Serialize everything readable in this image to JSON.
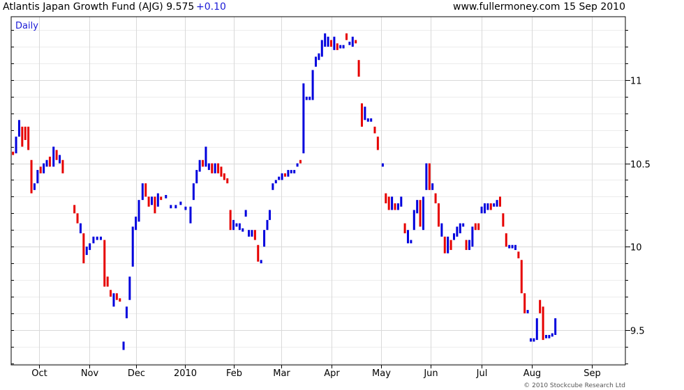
{
  "header": {
    "title": "Atlantis Japan Growth Fund (AJG) 9.575",
    "change": "+0.10",
    "site": "www.fullermoney.com",
    "date": "15 Sep 2010"
  },
  "footer": {
    "copyright": "© 2010 Stockcube Research Ltd"
  },
  "colors": {
    "up": "#0000dd",
    "down": "#e60000",
    "grid": "#d9d9d9",
    "frame": "#000000"
  },
  "chart_data": {
    "type": "bar",
    "period_label": "Daily",
    "ylim": [
      9.29,
      11.38
    ],
    "yticks": [
      9.5,
      10,
      10.5,
      11
    ],
    "y_tick_labels": [
      "9.5",
      "10",
      "10.5",
      "11"
    ],
    "x_tick_labels": [
      "Oct",
      "Nov",
      "Dec",
      "2010",
      "Feb",
      "Mar",
      "Apr",
      "May",
      "Jun",
      "Jul",
      "Aug",
      "Sep"
    ],
    "x_tick_positions": [
      0.045,
      0.127,
      0.203,
      0.283,
      0.363,
      0.44,
      0.522,
      0.602,
      0.683,
      0.766,
      0.848,
      0.945
    ],
    "bars": [
      {
        "x": 0.003,
        "low": 10.55,
        "high": 10.57,
        "up": false
      },
      {
        "x": 0.008,
        "low": 10.56,
        "high": 10.66,
        "up": true
      },
      {
        "x": 0.013,
        "low": 10.66,
        "high": 10.76,
        "up": true
      },
      {
        "x": 0.018,
        "low": 10.6,
        "high": 10.72,
        "up": false
      },
      {
        "x": 0.023,
        "low": 10.64,
        "high": 10.72,
        "up": false
      },
      {
        "x": 0.028,
        "low": 10.58,
        "high": 10.72,
        "up": false
      },
      {
        "x": 0.033,
        "low": 10.32,
        "high": 10.52,
        "up": false
      },
      {
        "x": 0.038,
        "low": 10.34,
        "high": 10.38,
        "up": true
      },
      {
        "x": 0.043,
        "low": 10.38,
        "high": 10.46,
        "up": true
      },
      {
        "x": 0.048,
        "low": 10.44,
        "high": 10.48,
        "up": false
      },
      {
        "x": 0.053,
        "low": 10.44,
        "high": 10.5,
        "up": true
      },
      {
        "x": 0.058,
        "low": 10.48,
        "high": 10.52,
        "up": true
      },
      {
        "x": 0.063,
        "low": 10.48,
        "high": 10.54,
        "up": false
      },
      {
        "x": 0.069,
        "low": 10.48,
        "high": 10.6,
        "up": true
      },
      {
        "x": 0.074,
        "low": 10.52,
        "high": 10.58,
        "up": false
      },
      {
        "x": 0.079,
        "low": 10.5,
        "high": 10.55,
        "up": true
      },
      {
        "x": 0.084,
        "low": 10.44,
        "high": 10.52,
        "up": false
      },
      {
        "x": 0.103,
        "low": 10.2,
        "high": 10.25,
        "up": false
      },
      {
        "x": 0.108,
        "low": 10.14,
        "high": 10.2,
        "up": false
      },
      {
        "x": 0.113,
        "low": 10.08,
        "high": 10.14,
        "up": true
      },
      {
        "x": 0.118,
        "low": 9.9,
        "high": 10.08,
        "up": false
      },
      {
        "x": 0.123,
        "low": 9.95,
        "high": 10.0,
        "up": true
      },
      {
        "x": 0.128,
        "low": 9.98,
        "high": 10.02,
        "up": true
      },
      {
        "x": 0.134,
        "low": 10.02,
        "high": 10.06,
        "up": true
      },
      {
        "x": 0.14,
        "low": 10.04,
        "high": 10.06,
        "up": true
      },
      {
        "x": 0.146,
        "low": 10.04,
        "high": 10.06,
        "up": true
      },
      {
        "x": 0.152,
        "low": 9.76,
        "high": 10.04,
        "up": false
      },
      {
        "x": 0.157,
        "low": 9.76,
        "high": 9.82,
        "up": false
      },
      {
        "x": 0.162,
        "low": 9.7,
        "high": 9.74,
        "up": false
      },
      {
        "x": 0.167,
        "low": 9.64,
        "high": 9.72,
        "up": true
      },
      {
        "x": 0.172,
        "low": 9.68,
        "high": 9.72,
        "up": false
      },
      {
        "x": 0.177,
        "low": 9.67,
        "high": 9.69,
        "up": false
      },
      {
        "x": 0.183,
        "low": 9.38,
        "high": 9.43,
        "up": true
      },
      {
        "x": 0.188,
        "low": 9.57,
        "high": 9.64,
        "up": true
      },
      {
        "x": 0.193,
        "low": 9.68,
        "high": 9.82,
        "up": true
      },
      {
        "x": 0.198,
        "low": 9.88,
        "high": 10.12,
        "up": true
      },
      {
        "x": 0.203,
        "low": 10.1,
        "high": 10.18,
        "up": true
      },
      {
        "x": 0.208,
        "low": 10.15,
        "high": 10.28,
        "up": true
      },
      {
        "x": 0.214,
        "low": 10.28,
        "high": 10.38,
        "up": true
      },
      {
        "x": 0.219,
        "low": 10.3,
        "high": 10.38,
        "up": false
      },
      {
        "x": 0.224,
        "low": 10.24,
        "high": 10.3,
        "up": false
      },
      {
        "x": 0.229,
        "low": 10.25,
        "high": 10.3,
        "up": true
      },
      {
        "x": 0.234,
        "low": 10.2,
        "high": 10.3,
        "up": false
      },
      {
        "x": 0.239,
        "low": 10.24,
        "high": 10.32,
        "up": true
      },
      {
        "x": 0.244,
        "low": 10.28,
        "high": 10.3,
        "up": false
      },
      {
        "x": 0.252,
        "low": 10.29,
        "high": 10.31,
        "up": true
      },
      {
        "x": 0.26,
        "low": 10.23,
        "high": 10.25,
        "up": true
      },
      {
        "x": 0.268,
        "low": 10.23,
        "high": 10.25,
        "up": true
      },
      {
        "x": 0.276,
        "low": 10.25,
        "high": 10.27,
        "up": true
      },
      {
        "x": 0.284,
        "low": 10.22,
        "high": 10.24,
        "up": true
      },
      {
        "x": 0.292,
        "low": 10.14,
        "high": 10.24,
        "up": true
      },
      {
        "x": 0.297,
        "low": 10.28,
        "high": 10.38,
        "up": true
      },
      {
        "x": 0.302,
        "low": 10.38,
        "high": 10.46,
        "up": true
      },
      {
        "x": 0.307,
        "low": 10.45,
        "high": 10.52,
        "up": true
      },
      {
        "x": 0.312,
        "low": 10.48,
        "high": 10.52,
        "up": false
      },
      {
        "x": 0.317,
        "low": 10.48,
        "high": 10.6,
        "up": true
      },
      {
        "x": 0.322,
        "low": 10.46,
        "high": 10.5,
        "up": true
      },
      {
        "x": 0.327,
        "low": 10.44,
        "high": 10.5,
        "up": false
      },
      {
        "x": 0.332,
        "low": 10.44,
        "high": 10.5,
        "up": true
      },
      {
        "x": 0.337,
        "low": 10.44,
        "high": 10.5,
        "up": false
      },
      {
        "x": 0.342,
        "low": 10.42,
        "high": 10.48,
        "up": false
      },
      {
        "x": 0.347,
        "low": 10.4,
        "high": 10.44,
        "up": false
      },
      {
        "x": 0.352,
        "low": 10.38,
        "high": 10.41,
        "up": false
      },
      {
        "x": 0.357,
        "low": 10.1,
        "high": 10.22,
        "up": false
      },
      {
        "x": 0.362,
        "low": 10.1,
        "high": 10.16,
        "up": true
      },
      {
        "x": 0.367,
        "low": 10.12,
        "high": 10.14,
        "up": true
      },
      {
        "x": 0.372,
        "low": 10.1,
        "high": 10.14,
        "up": true
      },
      {
        "x": 0.377,
        "low": 10.09,
        "high": 10.11,
        "up": true
      },
      {
        "x": 0.382,
        "low": 10.18,
        "high": 10.22,
        "up": true
      },
      {
        "x": 0.387,
        "low": 10.06,
        "high": 10.1,
        "up": true
      },
      {
        "x": 0.392,
        "low": 10.06,
        "high": 10.1,
        "up": true
      },
      {
        "x": 0.397,
        "low": 10.04,
        "high": 10.1,
        "up": false
      },
      {
        "x": 0.402,
        "low": 9.91,
        "high": 10.01,
        "up": false
      },
      {
        "x": 0.407,
        "low": 9.9,
        "high": 9.92,
        "up": true
      },
      {
        "x": 0.412,
        "low": 10.0,
        "high": 10.1,
        "up": true
      },
      {
        "x": 0.417,
        "low": 10.1,
        "high": 10.16,
        "up": true
      },
      {
        "x": 0.421,
        "low": 10.16,
        "high": 10.22,
        "up": true
      },
      {
        "x": 0.426,
        "low": 10.34,
        "high": 10.38,
        "up": true
      },
      {
        "x": 0.431,
        "low": 10.38,
        "high": 10.4,
        "up": true
      },
      {
        "x": 0.436,
        "low": 10.4,
        "high": 10.42,
        "up": true
      },
      {
        "x": 0.441,
        "low": 10.4,
        "high": 10.44,
        "up": true
      },
      {
        "x": 0.446,
        "low": 10.42,
        "high": 10.44,
        "up": false
      },
      {
        "x": 0.451,
        "low": 10.42,
        "high": 10.46,
        "up": true
      },
      {
        "x": 0.456,
        "low": 10.44,
        "high": 10.46,
        "up": true
      },
      {
        "x": 0.461,
        "low": 10.44,
        "high": 10.46,
        "up": true
      },
      {
        "x": 0.466,
        "low": 10.48,
        "high": 10.5,
        "up": true
      },
      {
        "x": 0.471,
        "low": 10.5,
        "high": 10.52,
        "up": false
      },
      {
        "x": 0.476,
        "low": 10.56,
        "high": 10.98,
        "up": true
      },
      {
        "x": 0.481,
        "low": 10.88,
        "high": 10.9,
        "up": true
      },
      {
        "x": 0.486,
        "low": 10.88,
        "high": 10.9,
        "up": true
      },
      {
        "x": 0.491,
        "low": 10.88,
        "high": 11.06,
        "up": true
      },
      {
        "x": 0.496,
        "low": 11.08,
        "high": 11.14,
        "up": true
      },
      {
        "x": 0.501,
        "low": 11.12,
        "high": 11.16,
        "up": true
      },
      {
        "x": 0.506,
        "low": 11.14,
        "high": 11.24,
        "up": true
      },
      {
        "x": 0.511,
        "low": 11.2,
        "high": 11.28,
        "up": true
      },
      {
        "x": 0.516,
        "low": 11.2,
        "high": 11.26,
        "up": true
      },
      {
        "x": 0.521,
        "low": 11.2,
        "high": 11.24,
        "up": false
      },
      {
        "x": 0.526,
        "low": 11.18,
        "high": 11.26,
        "up": true
      },
      {
        "x": 0.531,
        "low": 11.18,
        "high": 11.22,
        "up": false
      },
      {
        "x": 0.536,
        "low": 11.19,
        "high": 11.21,
        "up": true
      },
      {
        "x": 0.541,
        "low": 11.19,
        "high": 11.21,
        "up": true
      },
      {
        "x": 0.546,
        "low": 11.24,
        "high": 11.28,
        "up": false
      },
      {
        "x": 0.551,
        "low": 11.21,
        "high": 11.23,
        "up": true
      },
      {
        "x": 0.556,
        "low": 11.2,
        "high": 11.26,
        "up": true
      },
      {
        "x": 0.561,
        "low": 11.22,
        "high": 11.24,
        "up": false
      },
      {
        "x": 0.566,
        "low": 11.02,
        "high": 11.12,
        "up": false
      },
      {
        "x": 0.571,
        "low": 10.72,
        "high": 10.86,
        "up": false
      },
      {
        "x": 0.576,
        "low": 10.76,
        "high": 10.84,
        "up": true
      },
      {
        "x": 0.581,
        "low": 10.75,
        "high": 10.77,
        "up": true
      },
      {
        "x": 0.586,
        "low": 10.75,
        "high": 10.77,
        "up": true
      },
      {
        "x": 0.592,
        "low": 10.68,
        "high": 10.72,
        "up": false
      },
      {
        "x": 0.597,
        "low": 10.58,
        "high": 10.66,
        "up": false
      },
      {
        "x": 0.605,
        "low": 10.48,
        "high": 10.5,
        "up": true
      },
      {
        "x": 0.61,
        "low": 10.26,
        "high": 10.32,
        "up": false
      },
      {
        "x": 0.615,
        "low": 10.22,
        "high": 10.3,
        "up": false
      },
      {
        "x": 0.62,
        "low": 10.22,
        "high": 10.3,
        "up": true
      },
      {
        "x": 0.625,
        "low": 10.22,
        "high": 10.26,
        "up": false
      },
      {
        "x": 0.63,
        "low": 10.22,
        "high": 10.26,
        "up": true
      },
      {
        "x": 0.635,
        "low": 10.24,
        "high": 10.3,
        "up": true
      },
      {
        "x": 0.641,
        "low": 10.08,
        "high": 10.14,
        "up": false
      },
      {
        "x": 0.646,
        "low": 10.02,
        "high": 10.1,
        "up": true
      },
      {
        "x": 0.651,
        "low": 10.02,
        "high": 10.04,
        "up": true
      },
      {
        "x": 0.656,
        "low": 10.1,
        "high": 10.22,
        "up": true
      },
      {
        "x": 0.661,
        "low": 10.2,
        "high": 10.28,
        "up": true
      },
      {
        "x": 0.666,
        "low": 10.12,
        "high": 10.28,
        "up": false
      },
      {
        "x": 0.671,
        "low": 10.1,
        "high": 10.3,
        "up": true
      },
      {
        "x": 0.676,
        "low": 10.34,
        "high": 10.5,
        "up": true
      },
      {
        "x": 0.681,
        "low": 10.34,
        "high": 10.5,
        "up": false
      },
      {
        "x": 0.686,
        "low": 10.34,
        "high": 10.38,
        "up": true
      },
      {
        "x": 0.691,
        "low": 10.26,
        "high": 10.32,
        "up": false
      },
      {
        "x": 0.696,
        "low": 10.12,
        "high": 10.26,
        "up": false
      },
      {
        "x": 0.701,
        "low": 10.06,
        "high": 10.14,
        "up": true
      },
      {
        "x": 0.706,
        "low": 9.96,
        "high": 10.06,
        "up": false
      },
      {
        "x": 0.711,
        "low": 9.96,
        "high": 10.06,
        "up": true
      },
      {
        "x": 0.716,
        "low": 9.98,
        "high": 10.04,
        "up": false
      },
      {
        "x": 0.721,
        "low": 10.04,
        "high": 10.08,
        "up": true
      },
      {
        "x": 0.726,
        "low": 10.06,
        "high": 10.12,
        "up": true
      },
      {
        "x": 0.731,
        "low": 10.08,
        "high": 10.14,
        "up": true
      },
      {
        "x": 0.736,
        "low": 10.12,
        "high": 10.14,
        "up": true
      },
      {
        "x": 0.741,
        "low": 9.98,
        "high": 10.04,
        "up": false
      },
      {
        "x": 0.746,
        "low": 9.98,
        "high": 10.04,
        "up": true
      },
      {
        "x": 0.751,
        "low": 10.0,
        "high": 10.12,
        "up": true
      },
      {
        "x": 0.756,
        "low": 10.1,
        "high": 10.14,
        "up": false
      },
      {
        "x": 0.761,
        "low": 10.1,
        "high": 10.14,
        "up": false
      },
      {
        "x": 0.766,
        "low": 10.2,
        "high": 10.24,
        "up": true
      },
      {
        "x": 0.771,
        "low": 10.2,
        "high": 10.26,
        "up": true
      },
      {
        "x": 0.776,
        "low": 10.22,
        "high": 10.26,
        "up": true
      },
      {
        "x": 0.781,
        "low": 10.22,
        "high": 10.26,
        "up": false
      },
      {
        "x": 0.786,
        "low": 10.24,
        "high": 10.26,
        "up": true
      },
      {
        "x": 0.791,
        "low": 10.24,
        "high": 10.28,
        "up": true
      },
      {
        "x": 0.796,
        "low": 10.24,
        "high": 10.3,
        "up": false
      },
      {
        "x": 0.801,
        "low": 10.12,
        "high": 10.2,
        "up": false
      },
      {
        "x": 0.806,
        "low": 10.0,
        "high": 10.08,
        "up": false
      },
      {
        "x": 0.811,
        "low": 9.99,
        "high": 10.01,
        "up": true
      },
      {
        "x": 0.816,
        "low": 9.99,
        "high": 10.01,
        "up": true
      },
      {
        "x": 0.821,
        "low": 9.98,
        "high": 10.01,
        "up": true
      },
      {
        "x": 0.826,
        "low": 9.93,
        "high": 9.97,
        "up": false
      },
      {
        "x": 0.831,
        "low": 9.72,
        "high": 9.92,
        "up": false
      },
      {
        "x": 0.836,
        "low": 9.6,
        "high": 9.72,
        "up": false
      },
      {
        "x": 0.841,
        "low": 9.6,
        "high": 9.62,
        "up": true
      },
      {
        "x": 0.846,
        "low": 9.43,
        "high": 9.45,
        "up": true
      },
      {
        "x": 0.851,
        "low": 9.43,
        "high": 9.45,
        "up": true
      },
      {
        "x": 0.856,
        "low": 9.44,
        "high": 9.57,
        "up": true
      },
      {
        "x": 0.861,
        "low": 9.6,
        "high": 9.68,
        "up": false
      },
      {
        "x": 0.866,
        "low": 9.44,
        "high": 9.64,
        "up": false
      },
      {
        "x": 0.871,
        "low": 9.45,
        "high": 9.47,
        "up": true
      },
      {
        "x": 0.876,
        "low": 9.45,
        "high": 9.47,
        "up": true
      },
      {
        "x": 0.881,
        "low": 9.46,
        "high": 9.48,
        "up": true
      },
      {
        "x": 0.886,
        "low": 9.47,
        "high": 9.57,
        "up": true
      }
    ]
  }
}
